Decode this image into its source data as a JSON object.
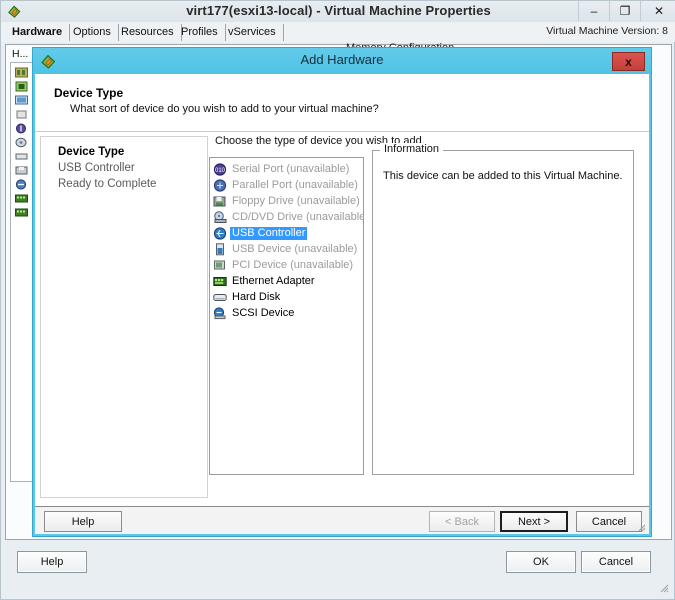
{
  "parent_window": {
    "title": "virt177(esxi13-local) - Virtual Machine Properties",
    "title_icon": "vsphere-tag-icon",
    "system_buttons": {
      "minimize": "–",
      "maximize": "❐",
      "close": "✕"
    },
    "tabs": [
      {
        "label": "Hardware",
        "active": true
      },
      {
        "label": "Options",
        "active": false
      },
      {
        "label": "Resources",
        "active": false
      },
      {
        "label": "Profiles",
        "active": false
      },
      {
        "label": "vServices",
        "active": false
      }
    ],
    "version_label": "Virtual Machine Version: 8",
    "hardware_column_header": "H...",
    "obscured_section_label": "Memory Configuration",
    "buttons": {
      "help": "Help",
      "ok": "OK",
      "cancel": "Cancel"
    }
  },
  "dialog": {
    "title": "Add Hardware",
    "title_icon": "vsphere-tag-icon",
    "close_label": "x",
    "header": {
      "title": "Device Type",
      "subtitle": "What sort of device do you wish to add to your virtual machine?"
    },
    "nav_items": [
      {
        "label": "Device Type",
        "state": "current"
      },
      {
        "label": "USB Controller",
        "state": "pending"
      },
      {
        "label": "Ready to Complete",
        "state": "pending"
      }
    ],
    "choose_label": "Choose the type of device you wish to add.",
    "devices": [
      {
        "label": "Serial Port (unavailable)",
        "icon": "serial-port-icon",
        "available": false,
        "selected": false
      },
      {
        "label": "Parallel Port (unavailable)",
        "icon": "parallel-port-icon",
        "available": false,
        "selected": false
      },
      {
        "label": "Floppy Drive (unavailable)",
        "icon": "floppy-drive-icon",
        "available": false,
        "selected": false
      },
      {
        "label": "CD/DVD Drive (unavailable)",
        "icon": "cd-dvd-drive-icon",
        "available": false,
        "selected": false
      },
      {
        "label": "USB Controller",
        "icon": "usb-controller-icon",
        "available": true,
        "selected": true
      },
      {
        "label": "USB Device (unavailable)",
        "icon": "usb-device-icon",
        "available": false,
        "selected": false
      },
      {
        "label": "PCI Device (unavailable)",
        "icon": "pci-device-icon",
        "available": false,
        "selected": false
      },
      {
        "label": "Ethernet Adapter",
        "icon": "ethernet-adapter-icon",
        "available": true,
        "selected": false
      },
      {
        "label": "Hard Disk",
        "icon": "hard-disk-icon",
        "available": true,
        "selected": false
      },
      {
        "label": "SCSI Device",
        "icon": "scsi-device-icon",
        "available": true,
        "selected": false
      }
    ],
    "information": {
      "legend": "Information",
      "text": "This device can be added to this Virtual Machine."
    },
    "footer_buttons": {
      "help": "Help",
      "back": "< Back",
      "next": "Next >",
      "cancel": "Cancel"
    }
  },
  "colors": {
    "dialog_titlebar": "#56c5e7",
    "selection_blue": "#3399ff",
    "close_button_red": "#c9443e",
    "window_chrome": "#e9eef2"
  }
}
